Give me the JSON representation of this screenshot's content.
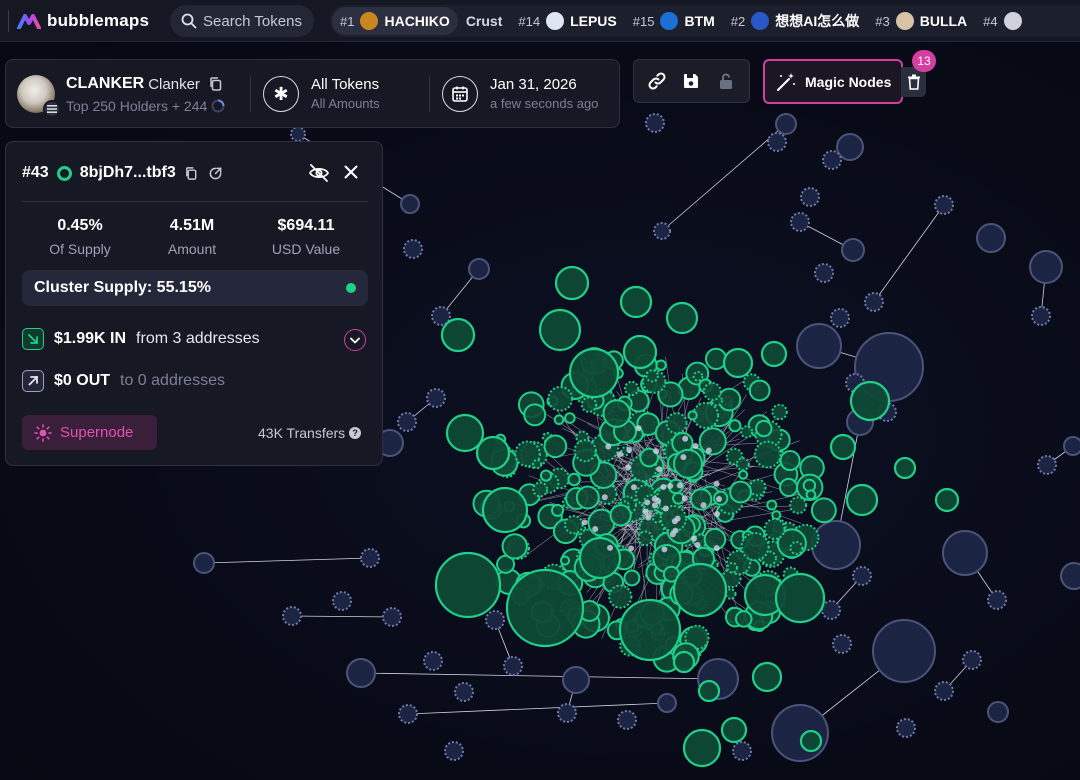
{
  "app": {
    "name": "bubblemaps"
  },
  "search": {
    "label": "Search Tokens"
  },
  "ticker": [
    {
      "rank": "#1",
      "name": "HACHIKO",
      "active": true,
      "logo_color": "#c8861f"
    },
    {
      "rank": "",
      "name": "Crust",
      "active": false,
      "logo_color": ""
    },
    {
      "rank": "#14",
      "name": "LEPUS",
      "active": false,
      "logo_color": "#dfe6f2"
    },
    {
      "rank": "#15",
      "name": "BTM",
      "active": false,
      "logo_color": "#1d6fd8"
    },
    {
      "rank": "#2",
      "name": "想想AI怎么做",
      "active": false,
      "logo_color": "#2a58c9"
    },
    {
      "rank": "#3",
      "name": "BULLA",
      "active": false,
      "logo_color": "#d9c3a8"
    },
    {
      "rank": "#4",
      "name": "",
      "active": false,
      "logo_color": "#cfd2da"
    }
  ],
  "token": {
    "symbol": "CLANKER",
    "name": "Clanker",
    "subtitle": "Top 250 Holders + 244"
  },
  "filters": {
    "tokens_title": "All Tokens",
    "tokens_sub": "All Amounts",
    "date_title": "Jan 31, 2026",
    "date_sub": "a few seconds ago"
  },
  "magic": {
    "label": "Magic Nodes",
    "count": "13"
  },
  "detail": {
    "rank": "#43",
    "address": "8bjDh7...tbf3",
    "supply_pct": "0.45%",
    "supply_label": "Of Supply",
    "amount": "4.51M",
    "amount_label": "Amount",
    "usd_value": "$694.11",
    "usd_label": "USD Value",
    "cluster_supply": "Cluster Supply: 55.15%",
    "in_amount": "$1.99K IN",
    "in_desc": "from 3 addresses",
    "out_amount": "$0 OUT",
    "out_desc": "to 0 addresses",
    "supernode_label": "Supernode",
    "transfers": "43K Transfers"
  },
  "colors": {
    "accent_pink": "#d43ea0",
    "cluster_green": "#1fd08a",
    "node_navy": "#1c2444",
    "node_border": "#4b5478"
  }
}
